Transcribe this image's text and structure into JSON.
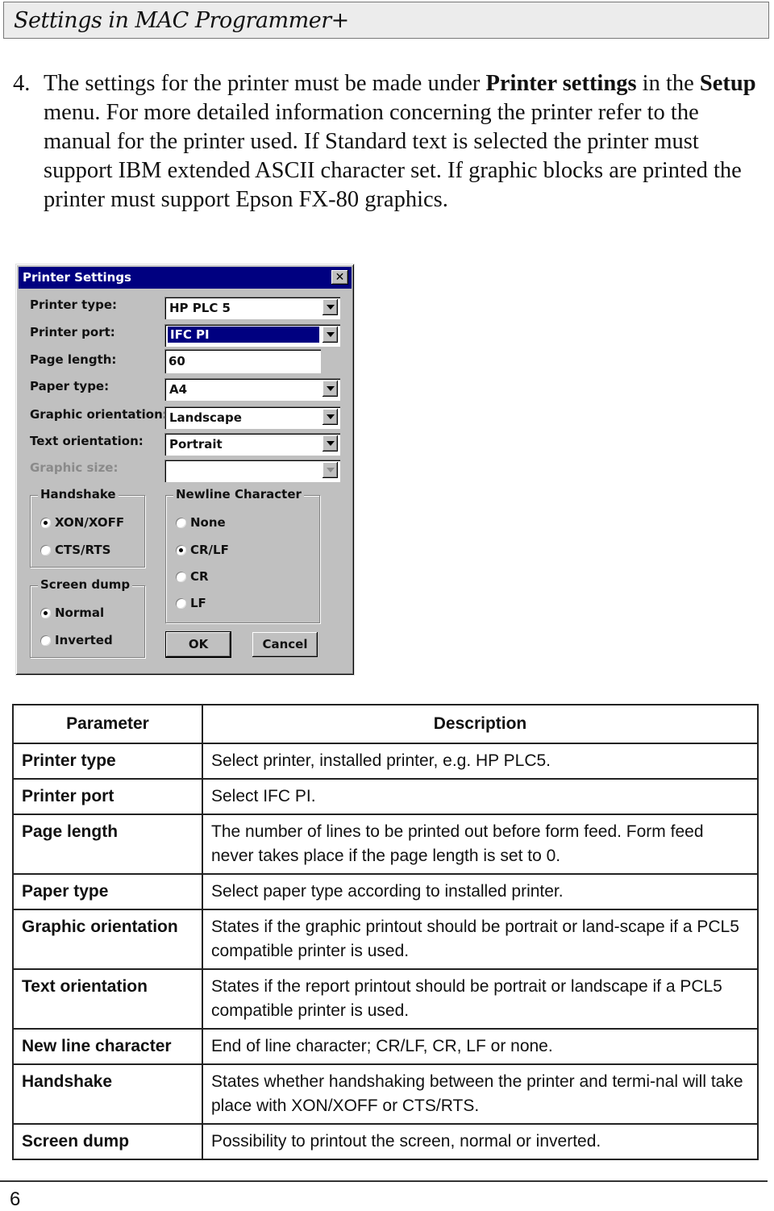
{
  "header": {
    "title": "Settings in MAC Programmer+"
  },
  "intro": {
    "number": "4.",
    "text_1": "The settings for the printer must be made under ",
    "bold_1": "Printer settings",
    "text_2": " in the ",
    "bold_2": "Setup",
    "text_3": " menu. For more detailed information concerning the printer refer to the manual for the printer used. If Standard text is selected the printer must support IBM extended ASCII character set. If graphic blocks are printed the printer must support Epson FX-80 graphics."
  },
  "dialog": {
    "title": "Printer Settings",
    "close_glyph": "✕",
    "fields": {
      "printer_type": {
        "label": "Printer type:",
        "value": "HP PLC 5"
      },
      "printer_port": {
        "label": "Printer port:",
        "value": "IFC PI"
      },
      "page_length": {
        "label": "Page length:",
        "value": "60"
      },
      "paper_type": {
        "label": "Paper type:",
        "value": "A4"
      },
      "graphic_orientation": {
        "label": "Graphic orientation:",
        "value": "Landscape"
      },
      "text_orientation": {
        "label": "Text orientation:",
        "value": "Portrait"
      },
      "graphic_size": {
        "label": "Graphic size:",
        "value": ""
      }
    },
    "handshake": {
      "title": "Handshake",
      "options": [
        "XON/XOFF",
        "CTS/RTS"
      ],
      "selected": "XON/XOFF"
    },
    "screen_dump": {
      "title": "Screen dump",
      "options": [
        "Normal",
        "Inverted"
      ],
      "selected": "Normal"
    },
    "newline": {
      "title": "Newline Character",
      "options": [
        "None",
        "CR/LF",
        "CR",
        "LF"
      ],
      "selected": "CR/LF"
    },
    "ok_label": "OK",
    "cancel_label": "Cancel"
  },
  "table": {
    "headers": [
      "Parameter",
      "Description"
    ],
    "rows": [
      {
        "param": "Printer type",
        "desc": "Select printer, installed printer, e.g. HP PLC5."
      },
      {
        "param": "Printer port",
        "desc": "Select IFC PI."
      },
      {
        "param": "Page length",
        "desc": "The number of lines to be printed out before form feed. Form feed never takes place if the page length is set to 0."
      },
      {
        "param": "Paper type",
        "desc": "Select paper type according to installed printer."
      },
      {
        "param": "Graphic orientation",
        "desc": "States if the graphic printout should be portrait or land-scape if a PCL5 compatible printer is used."
      },
      {
        "param": "Text orientation",
        "desc": "States if the report printout should be portrait or landscape if a PCL5 compatible printer is used."
      },
      {
        "param": "New line character",
        "desc": "End of line character; CR/LF, CR, LF or none."
      },
      {
        "param": "Handshake",
        "desc": "States whether handshaking between the printer and termi-nal will take place with XON/XOFF or CTS/RTS."
      },
      {
        "param": "Screen dump",
        "desc": "Possibility to printout the screen, normal or inverted."
      }
    ]
  },
  "footer": {
    "page_number": "6"
  }
}
